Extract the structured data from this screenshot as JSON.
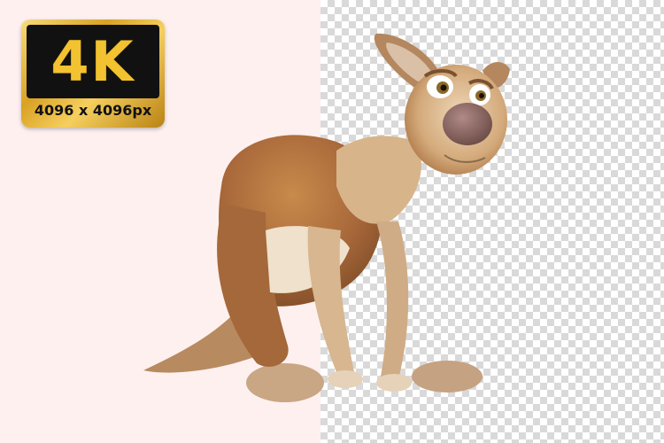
{
  "badge": {
    "resolution_label": "4K",
    "dimensions_label": "4096 x 4096px"
  },
  "background": {
    "left_color": "#fdf0ef",
    "checker_light": "#ffffff",
    "checker_dark": "#d9d9d9"
  },
  "subject": {
    "icon": "kangaroo-illustration"
  }
}
